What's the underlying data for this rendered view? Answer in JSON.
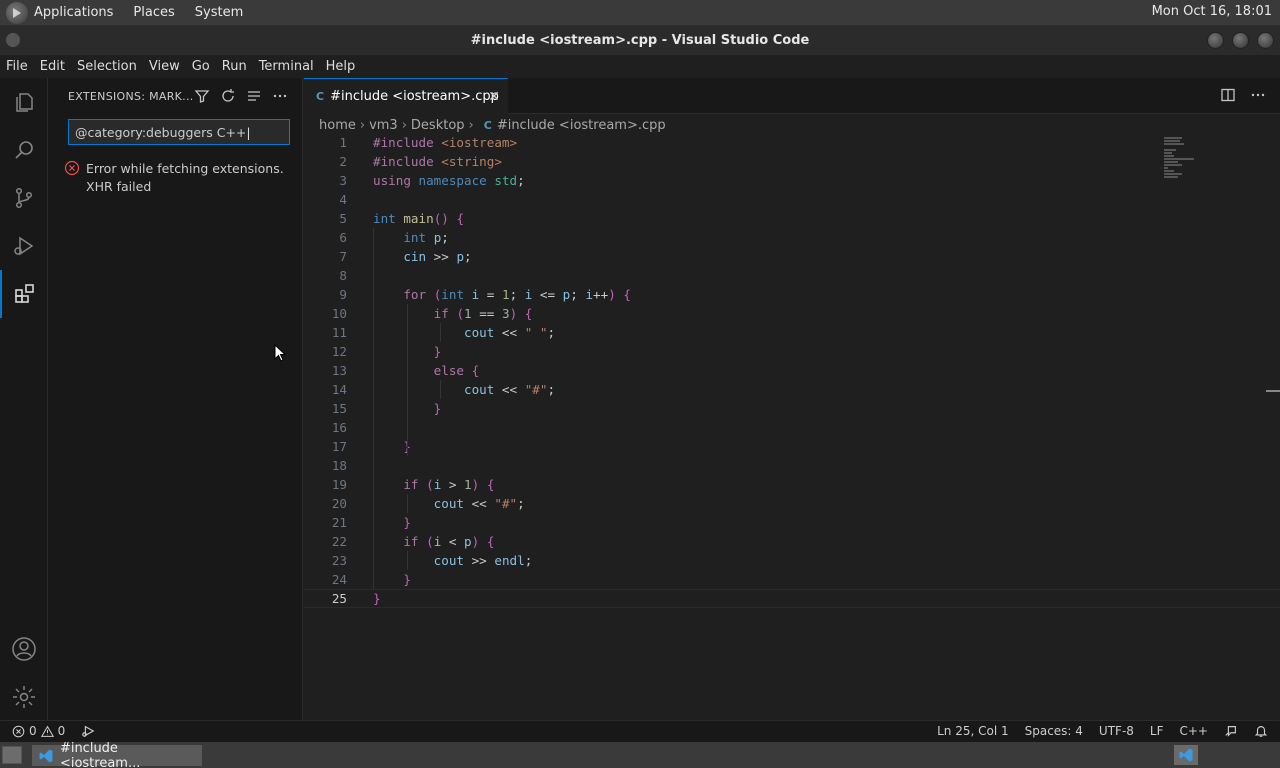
{
  "system_panel": {
    "menus": [
      "Applications",
      "Places",
      "System"
    ],
    "clock": "Mon Oct 16, 18:01"
  },
  "window": {
    "title": "#include <iostream>.cpp - Visual Studio Code"
  },
  "menubar": [
    "File",
    "Edit",
    "Selection",
    "View",
    "Go",
    "Run",
    "Terminal",
    "Help"
  ],
  "activity_bar": {
    "items": [
      "files-icon",
      "search-icon",
      "source-control-icon",
      "run-debug-icon",
      "extensions-icon"
    ],
    "bottom": [
      "account-icon",
      "settings-gear-icon"
    ],
    "active": "extensions-icon"
  },
  "sidebar": {
    "title": "EXTENSIONS: MARK...",
    "search_value": "@category:debuggers C++",
    "error_line1": "Error while fetching extensions.",
    "error_line2": "XHR failed"
  },
  "editor": {
    "tab_lang": "C",
    "tab_label": "#include <iostream>.cpp",
    "breadcrumb": [
      "home",
      "vm3",
      "Desktop",
      "#include <iostream>.cpp"
    ],
    "lines": [
      "#include <iostream>",
      "#include <string>",
      "using namespace std;",
      "",
      "int main() {",
      "    int p;",
      "    cin >> p;",
      "",
      "    for (int i = 1; i <= p; i++) {",
      "        if (1 == 3) {",
      "            cout << \" \";",
      "        }",
      "        else {",
      "            cout << \"#\";",
      "        }",
      "",
      "    }",
      "",
      "    if (i > 1) {",
      "        cout << \"#\";",
      "    }",
      "    if (i < p) {",
      "        cout >> endl;",
      "    }",
      "}"
    ],
    "line_numbers": [
      "1",
      "2",
      "3",
      "4",
      "5",
      "6",
      "7",
      "8",
      "9",
      "10",
      "11",
      "12",
      "13",
      "14",
      "15",
      "16",
      "17",
      "18",
      "19",
      "20",
      "21",
      "22",
      "23",
      "24",
      "25"
    ],
    "current_line": 25
  },
  "statusbar": {
    "errors": "0",
    "warnings": "0",
    "position": "Ln 25, Col 1",
    "spaces": "Spaces: 4",
    "encoding": "UTF-8",
    "eol": "LF",
    "language": "C++"
  },
  "taskbar": {
    "window_label": "#include <iostream..."
  },
  "colors": {
    "accent": "#0078d4",
    "error": "#f14c4c"
  }
}
